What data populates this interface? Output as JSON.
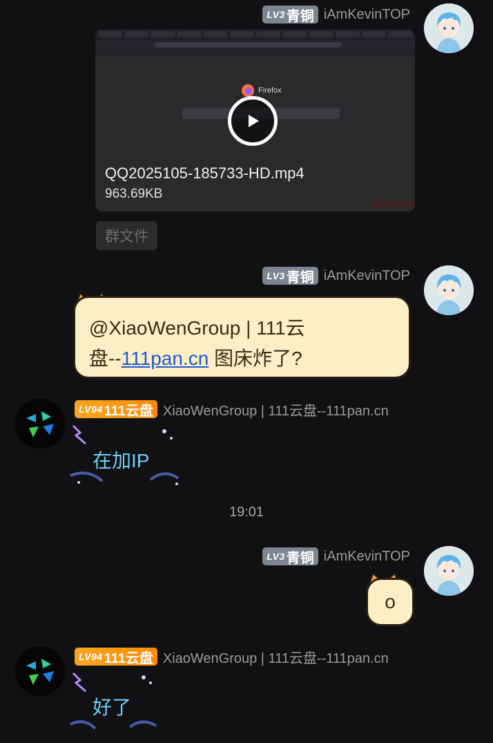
{
  "messages": [
    {
      "sender": {
        "level": "LV3",
        "rank": "青铜",
        "nick": "iAmKevinTOP"
      },
      "video": {
        "file_name": "QQ2025105-185733-HD.mp4",
        "file_size": "963.69KB",
        "thumb_app": "Firefox"
      },
      "tag": "群文件"
    },
    {
      "sender": {
        "level": "LV3",
        "rank": "青铜",
        "nick": "iAmKevinTOP"
      },
      "text_part1": "@XiaoWenGroup | 111云",
      "text_part2": "盘--",
      "link": "111pan.cn",
      "text_part3": " 图床炸了?"
    },
    {
      "sender": {
        "level": "LV94",
        "rank": "111云盘",
        "nick": "XiaoWenGroup | 111云盘--111pan.cn"
      },
      "text": "在加IP"
    },
    {
      "timestamp": "19:01"
    },
    {
      "sender": {
        "level": "LV3",
        "rank": "青铜",
        "nick": "iAmKevinTOP"
      },
      "text": "o"
    },
    {
      "sender": {
        "level": "LV94",
        "rank": "111云盘",
        "nick": "XiaoWenGroup | 111云盘--111pan.cn"
      },
      "text": "好了"
    }
  ],
  "colors": {
    "background": "#111113",
    "bubble_cat": "#fcefc6",
    "fancy_text": "#6fcff5",
    "badge_lv3": "#7d8591",
    "badge_lv94": "#f5a623",
    "link": "#1f5bd6"
  },
  "icons": [
    "play-icon",
    "avatar-anime-boy",
    "avatar-111pan-logo"
  ]
}
